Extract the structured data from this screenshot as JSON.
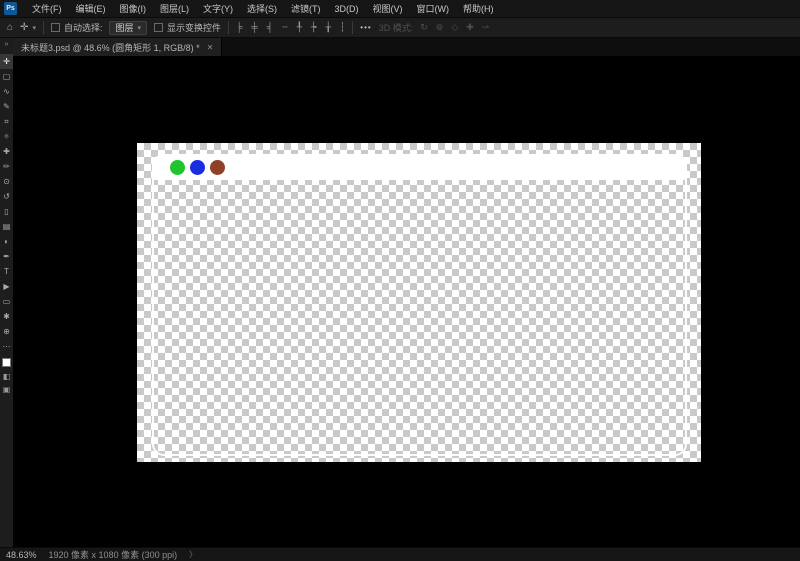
{
  "app": {
    "logo_text": "Ps"
  },
  "menu_bar": {
    "items": [
      "文件(F)",
      "编辑(E)",
      "图像(I)",
      "图层(L)",
      "文字(Y)",
      "选择(S)",
      "滤镜(T)",
      "3D(D)",
      "视图(V)",
      "窗口(W)",
      "帮助(H)"
    ]
  },
  "options_bar": {
    "home_icon": "⌂",
    "move_tool_icon": "✛",
    "caret_icon": "▾",
    "auto_select_label": "自动选择:",
    "auto_select_value": "图层",
    "show_transform_label": "显示变换控件",
    "align_icons": [
      "╞",
      "╪",
      "╡",
      "┄",
      "╀",
      "┾",
      "╁",
      "┆"
    ],
    "more_icon": "•••",
    "mode_label": "3D 模式:",
    "mode_icons": [
      "↻",
      "⊚",
      "◇",
      "✚",
      "⇀"
    ]
  },
  "tab": {
    "title": "未标题3.psd @ 48.6% (圆角矩形 1, RGB/8) *",
    "close_icon": "✕"
  },
  "tool_strip": {
    "collapse_icon": "»",
    "tools": [
      {
        "name": "move-tool",
        "glyph": "✛"
      },
      {
        "name": "marquee-tool",
        "glyph": "▢"
      },
      {
        "name": "lasso-tool",
        "glyph": "∿"
      },
      {
        "name": "quick-selection-tool",
        "glyph": "✎"
      },
      {
        "name": "crop-tool",
        "glyph": "⌗"
      },
      {
        "name": "eyedropper-tool",
        "glyph": "✧"
      },
      {
        "name": "healing-brush-tool",
        "glyph": "✚"
      },
      {
        "name": "brush-tool",
        "glyph": "✏"
      },
      {
        "name": "clone-stamp-tool",
        "glyph": "⊙"
      },
      {
        "name": "history-brush-tool",
        "glyph": "↺"
      },
      {
        "name": "eraser-tool",
        "glyph": "▯"
      },
      {
        "name": "gradient-tool",
        "glyph": "▤"
      },
      {
        "name": "dodge-tool",
        "glyph": "◐"
      },
      {
        "name": "pen-tool",
        "glyph": "✒"
      },
      {
        "name": "type-tool",
        "glyph": "T"
      },
      {
        "name": "path-selection-tool",
        "glyph": "▶"
      },
      {
        "name": "shape-tool",
        "glyph": "▭"
      },
      {
        "name": "hand-tool",
        "glyph": "✱"
      },
      {
        "name": "zoom-tool",
        "glyph": "⊕"
      },
      {
        "name": "edit-toolbar",
        "glyph": "⋯"
      }
    ],
    "quick_mask_icon": "◧",
    "screen_mode_icon": "▣"
  },
  "canvas": {
    "artwork": {
      "circles": [
        {
          "name": "green-circle",
          "color": "#1fc42f"
        },
        {
          "name": "blue-circle",
          "color": "#1b2de0"
        },
        {
          "name": "brown-circle",
          "color": "#8e4126"
        }
      ]
    }
  },
  "status_bar": {
    "zoom_level": "48.63%",
    "doc_info": "1920 像素 x 1080 像素 (300 ppi)",
    "chevron_icon": "〉"
  }
}
